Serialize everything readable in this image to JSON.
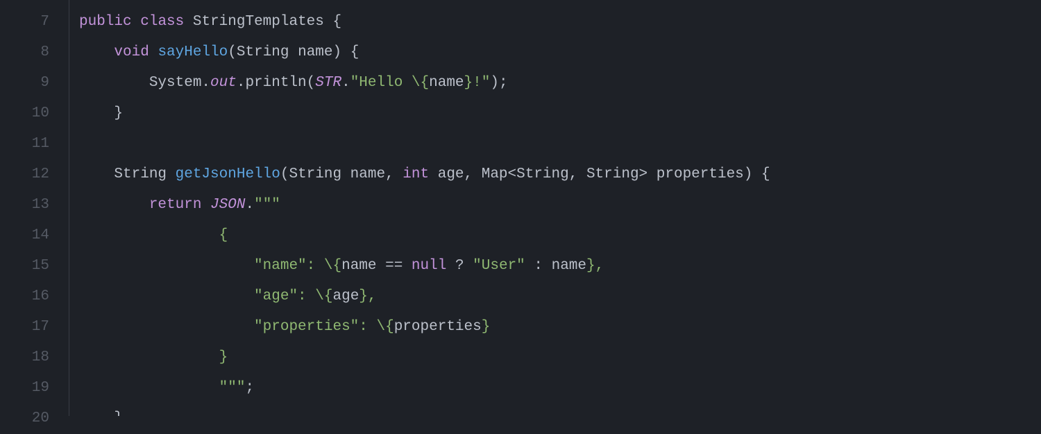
{
  "lines": [
    {
      "num": "7",
      "tokens": [
        {
          "cls": "mod",
          "t": "public"
        },
        {
          "cls": "pun",
          "t": " "
        },
        {
          "cls": "kw",
          "t": "class"
        },
        {
          "cls": "pun",
          "t": " "
        },
        {
          "cls": "cls",
          "t": "StringTemplates"
        },
        {
          "cls": "pun",
          "t": " {"
        }
      ]
    },
    {
      "num": "8",
      "tokens": [
        {
          "cls": "pun",
          "t": "    "
        },
        {
          "cls": "kw",
          "t": "void"
        },
        {
          "cls": "pun",
          "t": " "
        },
        {
          "cls": "mname",
          "t": "sayHello"
        },
        {
          "cls": "pun",
          "t": "(String name) {"
        }
      ]
    },
    {
      "num": "9",
      "tokens": [
        {
          "cls": "pun",
          "t": "        System."
        },
        {
          "cls": "stat",
          "t": "out"
        },
        {
          "cls": "pun",
          "t": ".println("
        },
        {
          "cls": "proc",
          "t": "STR"
        },
        {
          "cls": "pun",
          "t": "."
        },
        {
          "cls": "str",
          "t": "\"Hello "
        },
        {
          "cls": "escbr",
          "t": "\\{"
        },
        {
          "cls": "expr",
          "t": "name"
        },
        {
          "cls": "escbr",
          "t": "}"
        },
        {
          "cls": "str",
          "t": "!\""
        },
        {
          "cls": "pun",
          "t": ");"
        }
      ]
    },
    {
      "num": "10",
      "tokens": [
        {
          "cls": "pun",
          "t": "    }"
        }
      ]
    },
    {
      "num": "11",
      "tokens": [
        {
          "cls": "pun",
          "t": ""
        }
      ]
    },
    {
      "num": "12",
      "tokens": [
        {
          "cls": "pun",
          "t": "    String "
        },
        {
          "cls": "mname",
          "t": "getJsonHello"
        },
        {
          "cls": "pun",
          "t": "(String name, "
        },
        {
          "cls": "kw",
          "t": "int"
        },
        {
          "cls": "pun",
          "t": " age, Map<String, String> properties) {"
        }
      ]
    },
    {
      "num": "13",
      "tokens": [
        {
          "cls": "pun",
          "t": "        "
        },
        {
          "cls": "ret",
          "t": "return"
        },
        {
          "cls": "pun",
          "t": " "
        },
        {
          "cls": "proc",
          "t": "JSON"
        },
        {
          "cls": "pun",
          "t": "."
        },
        {
          "cls": "str",
          "t": "\"\"\""
        }
      ]
    },
    {
      "num": "14",
      "tokens": [
        {
          "cls": "pun",
          "t": "                "
        },
        {
          "cls": "str",
          "t": "{"
        }
      ]
    },
    {
      "num": "15",
      "tokens": [
        {
          "cls": "pun",
          "t": "                    "
        },
        {
          "cls": "str",
          "t": "\"name\": "
        },
        {
          "cls": "escbr",
          "t": "\\{"
        },
        {
          "cls": "expr",
          "t": "name == "
        },
        {
          "cls": "null",
          "t": "null"
        },
        {
          "cls": "expr",
          "t": " ? "
        },
        {
          "cls": "str",
          "t": "\"User\""
        },
        {
          "cls": "expr",
          "t": " : name"
        },
        {
          "cls": "escbr",
          "t": "}"
        },
        {
          "cls": "str",
          "t": ","
        }
      ]
    },
    {
      "num": "16",
      "tokens": [
        {
          "cls": "pun",
          "t": "                    "
        },
        {
          "cls": "str",
          "t": "\"age\": "
        },
        {
          "cls": "escbr",
          "t": "\\{"
        },
        {
          "cls": "expr",
          "t": "age"
        },
        {
          "cls": "escbr",
          "t": "}"
        },
        {
          "cls": "str",
          "t": ","
        }
      ]
    },
    {
      "num": "17",
      "tokens": [
        {
          "cls": "pun",
          "t": "                    "
        },
        {
          "cls": "str",
          "t": "\"properties\": "
        },
        {
          "cls": "escbr",
          "t": "\\{"
        },
        {
          "cls": "expr",
          "t": "properties"
        },
        {
          "cls": "escbr",
          "t": "}"
        }
      ]
    },
    {
      "num": "18",
      "tokens": [
        {
          "cls": "pun",
          "t": "                "
        },
        {
          "cls": "str",
          "t": "}"
        }
      ]
    },
    {
      "num": "19",
      "tokens": [
        {
          "cls": "pun",
          "t": "                "
        },
        {
          "cls": "str",
          "t": "\"\"\""
        },
        {
          "cls": "pun",
          "t": ";"
        }
      ]
    },
    {
      "num": "20",
      "tokens": [
        {
          "cls": "pun",
          "t": "    }"
        }
      ]
    }
  ]
}
